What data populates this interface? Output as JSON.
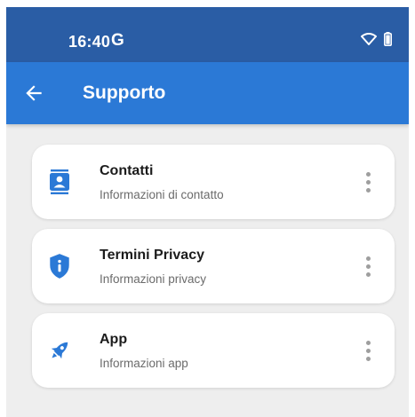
{
  "status_bar": {
    "time": "16:40",
    "notification_glyph": "G",
    "icons": [
      "wifi-icon",
      "battery-icon"
    ]
  },
  "app_bar": {
    "title": "Supporto",
    "back_icon": "arrow-back-icon",
    "color": "#2b79d6"
  },
  "items": [
    {
      "title": "Contatti",
      "subtitle": "Informazioni di contatto",
      "icon": "contact-card-icon"
    },
    {
      "title": "Termini Privacy",
      "subtitle": "Informazioni privacy",
      "icon": "shield-info-icon"
    },
    {
      "title": "App",
      "subtitle": "Informazioni app",
      "icon": "rocket-icon"
    }
  ],
  "colors": {
    "status_bar": "#2a5da5",
    "accent": "#2b79d6",
    "background": "#eeeeee"
  }
}
